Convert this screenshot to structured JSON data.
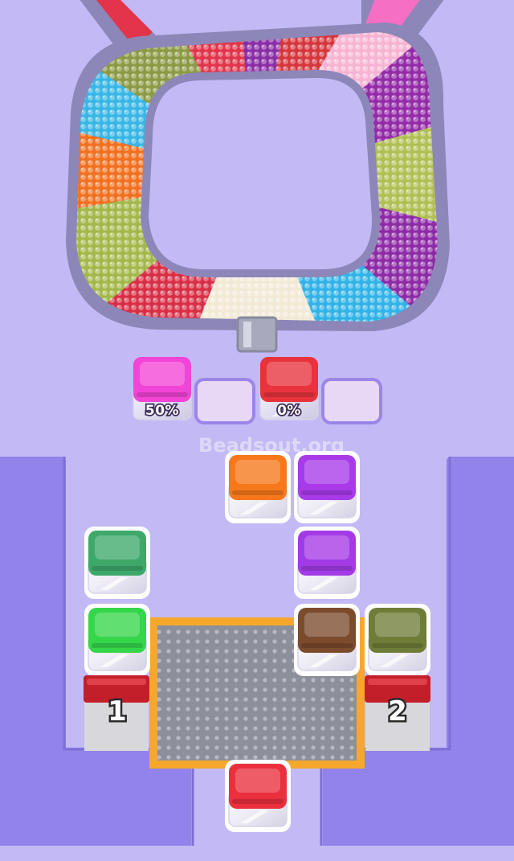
{
  "watermark": "Beadsout.org",
  "colors": {
    "background": "#c3b9f4",
    "walls": "#9183e9",
    "track": "#8c87b8"
  },
  "bead_track": {
    "segments": [
      {
        "color": "#e2344a"
      },
      {
        "color": "#8c9a45"
      },
      {
        "color": "#38b6e6"
      },
      {
        "color": "#f3701f"
      },
      {
        "color": "#a3b84a"
      },
      {
        "color": "#d92f46"
      },
      {
        "color": "#f2ead6"
      },
      {
        "color": "#31b3e8"
      },
      {
        "color": "#8e2ba6"
      },
      {
        "color": "#b1bf53"
      },
      {
        "color": "#942ba8"
      },
      {
        "color": "#f7b3d3"
      },
      {
        "color": "#d7363d"
      },
      {
        "color": "#8a2ea6"
      }
    ],
    "left_arm_color": "#e2344a",
    "right_arm_color": "#f56fc5"
  },
  "collector_slots": [
    {
      "state": "filled",
      "color": "#f244d6",
      "progress": "50%"
    },
    {
      "state": "empty"
    },
    {
      "state": "filled",
      "color": "#e8333c",
      "progress": "0%"
    },
    {
      "state": "empty"
    }
  ],
  "cups": [
    {
      "id": "orange",
      "color": "#f6781b"
    },
    {
      "id": "purple-top",
      "color": "#a83ae9"
    },
    {
      "id": "purple-mid",
      "color": "#a43ae6"
    },
    {
      "id": "teal-green",
      "color": "#3ea86a"
    },
    {
      "id": "bright-green",
      "color": "#35d64a"
    },
    {
      "id": "brown",
      "color": "#7b4b2c"
    },
    {
      "id": "olive",
      "color": "#6f7d39"
    },
    {
      "id": "red-bottom",
      "color": "#ea2f3d"
    }
  ],
  "launchers": [
    {
      "number": "1"
    },
    {
      "number": "2"
    }
  ]
}
